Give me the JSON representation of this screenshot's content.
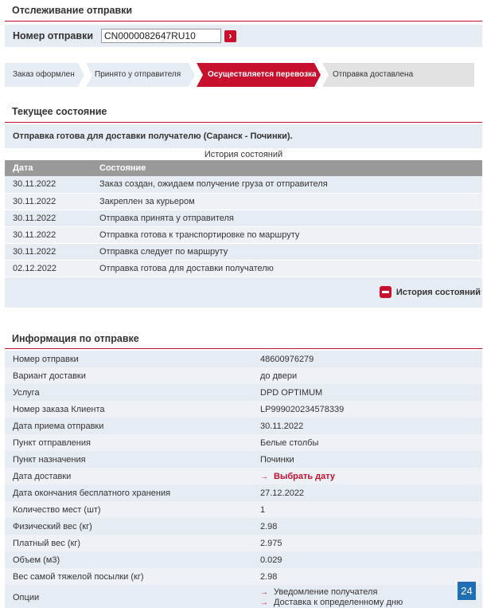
{
  "tracking": {
    "title": "Отслеживание отправки",
    "label": "Номер отправки",
    "value": "CN0000082647RU10"
  },
  "steps": [
    {
      "label": "Заказ оформлен",
      "state": "done"
    },
    {
      "label": "Принято у отправителя",
      "state": "done"
    },
    {
      "label": "Осуществляется перевозка",
      "state": "active"
    },
    {
      "label": "Отправка доставлена",
      "state": "pending"
    }
  ],
  "current": {
    "title": "Текущее состояние",
    "status": "Отправка готова для доставки получателю (Саранск - Починки)."
  },
  "history": {
    "caption": "История состояний",
    "headers": [
      "Дата",
      "Состояние"
    ],
    "rows": [
      [
        "30.11.2022",
        "Заказ создан, ожидаем получение груза от отправителя"
      ],
      [
        "30.11.2022",
        "Закреплен за курьером"
      ],
      [
        "30.11.2022",
        "Отправка принята у отправителя"
      ],
      [
        "30.11.2022",
        "Отправка готова к транспортировке по маршруту"
      ],
      [
        "30.11.2022",
        "Отправка следует по маршруту"
      ],
      [
        "02.12.2022",
        "Отправка готова для доставки получателю"
      ]
    ],
    "toggle_label": "История состояний"
  },
  "info": {
    "title": "Информация по отправке",
    "rows": [
      [
        "Номер отправки",
        "48600976279"
      ],
      [
        "Вариант доставки",
        "до двери"
      ],
      [
        "Услуга",
        "DPD OPTIMUM"
      ],
      [
        "Номер заказа Клиента",
        "LP999020234578339"
      ],
      [
        "Дата приема отправки",
        "30.11.2022"
      ],
      [
        "Пункт отправления",
        "Белые столбы"
      ],
      [
        "Пункт назначения",
        "Починки"
      ],
      [
        "Дата доставки",
        "Выбрать дату"
      ],
      [
        "Дата окончания бесплатного хранения",
        "27.12.2022"
      ],
      [
        "Количество мест (шт)",
        "1"
      ],
      [
        "Физический вес (кг)",
        "2.98"
      ],
      [
        "Платный вес (кг)",
        "2.975"
      ],
      [
        "Объем (м3)",
        "0.029"
      ],
      [
        "Вес самой тяжелой посылки (кг)",
        "2.98"
      ]
    ],
    "options_label": "Опции",
    "options": [
      "Уведомление получателя",
      "Доставка к определенному дню"
    ]
  },
  "badge": "24",
  "colors": {
    "accent": "#c8102e",
    "panel": "#e6ecf3",
    "header_gray": "#999999"
  }
}
